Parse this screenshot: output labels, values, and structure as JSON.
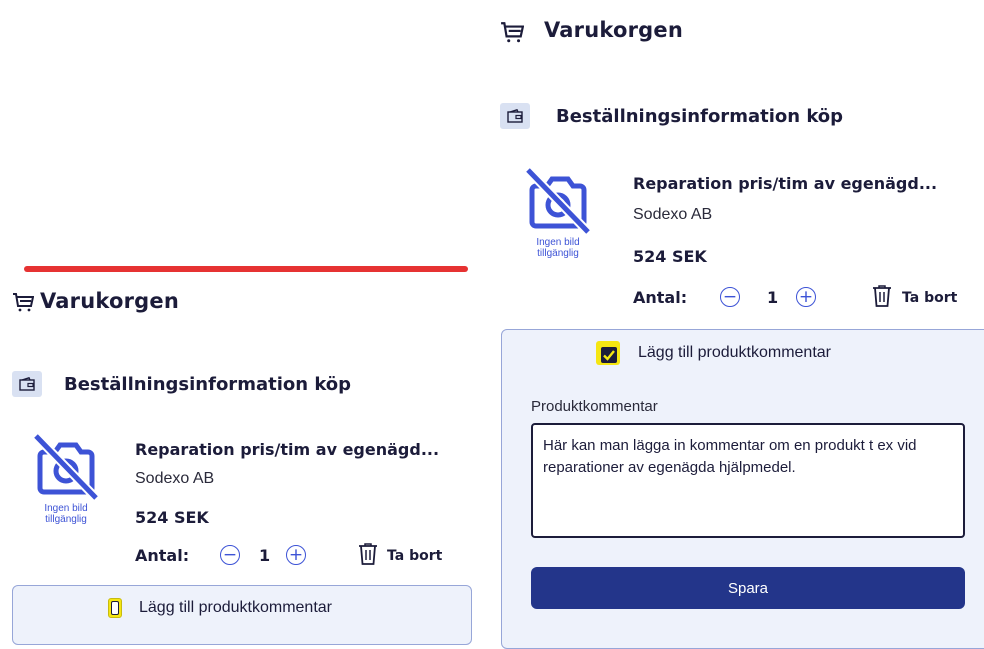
{
  "cart": {
    "title": "Varukorgen"
  },
  "order_section": {
    "title": "Beställningsinformation köp"
  },
  "product": {
    "name": "Reparation pris/tim av egenägd...",
    "supplier": "Sodexo AB",
    "price": "524 SEK",
    "quantity_label": "Antal:",
    "quantity": "1",
    "remove_label": "Ta bort",
    "no_image_text_line1": "Ingen bild",
    "no_image_text_line2": "tillgänglig"
  },
  "comment": {
    "toggle_label": "Lägg till produktkommentar",
    "field_label": "Produktkommentar",
    "value": "Här kan man lägga in kommentar om en produkt t ex vid reparationer av egenägda hjälpmedel.",
    "save_label": "Spara"
  },
  "colors": {
    "accent": "#3d53d6",
    "primary_button": "#23358a",
    "highlight": "#f5e612",
    "red_bar": "#e63232"
  }
}
